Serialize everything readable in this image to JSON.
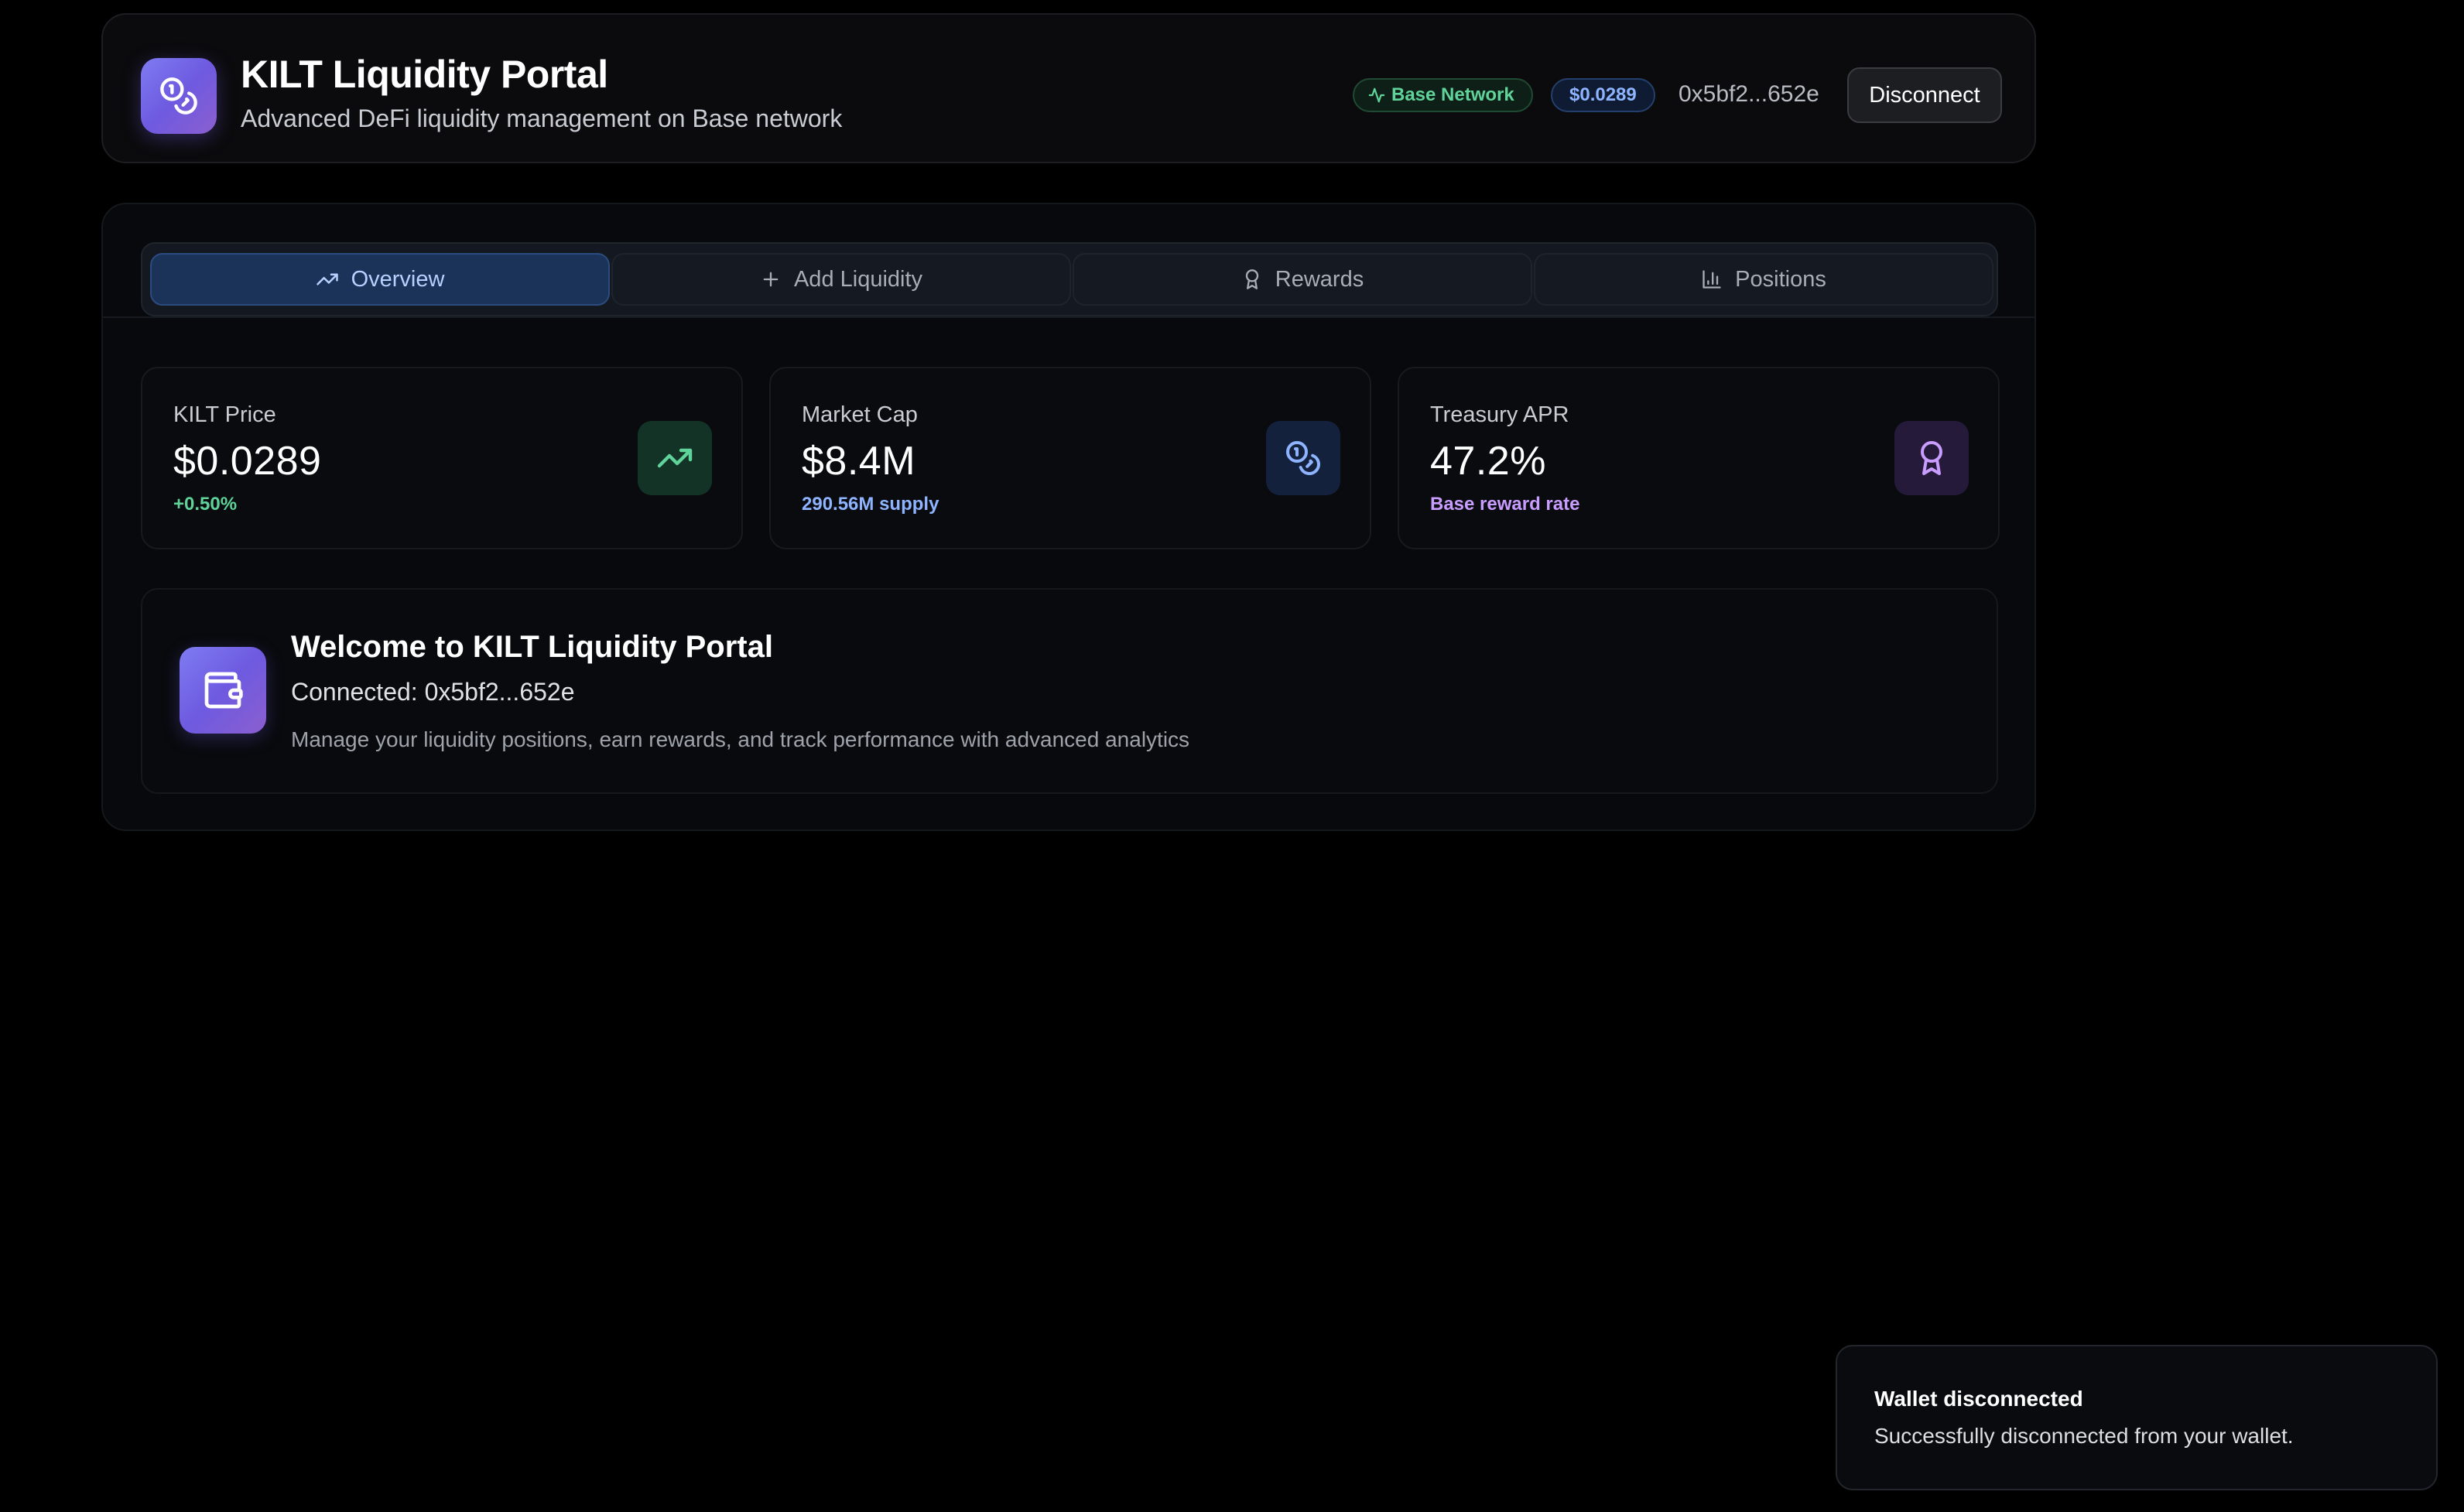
{
  "header": {
    "title": "KILT Liquidity Portal",
    "subtitle": "Advanced DeFi liquidity management on Base network",
    "network_badge": "Base Network",
    "price_badge": "$0.0289",
    "wallet_address": "0x5bf2...652e",
    "disconnect_label": "Disconnect",
    "logo_icon": "coins-icon"
  },
  "tabs": [
    {
      "label": "Overview",
      "icon": "trending-up-icon",
      "active": true
    },
    {
      "label": "Add Liquidity",
      "icon": "plus-icon",
      "active": false
    },
    {
      "label": "Rewards",
      "icon": "award-icon",
      "active": false
    },
    {
      "label": "Positions",
      "icon": "bar-chart-icon",
      "active": false
    }
  ],
  "stats": [
    {
      "label": "KILT Price",
      "value": "$0.0289",
      "note": "+0.50%",
      "note_color": "#5fd39a",
      "icon": "trending-up-icon",
      "icon_bg": "#143327",
      "icon_color": "#5fd39a"
    },
    {
      "label": "Market Cap",
      "value": "$8.4M",
      "note": "290.56M supply",
      "note_color": "#8fb4ff",
      "icon": "coins-icon",
      "icon_bg": "#14213d",
      "icon_color": "#8fb4ff"
    },
    {
      "label": "Treasury APR",
      "value": "47.2%",
      "note": "Base reward rate",
      "note_color": "#c99cff",
      "icon": "award-icon",
      "icon_bg": "#251a3a",
      "icon_color": "#c99cff"
    }
  ],
  "welcome": {
    "title": "Welcome to KILT Liquidity Portal",
    "connected": "Connected: 0x5bf2...652e",
    "description": "Manage your liquidity positions, earn rewards, and track performance with advanced analytics",
    "icon": "wallet-icon"
  },
  "toast": {
    "title": "Wallet disconnected",
    "message": "Successfully disconnected from your wallet."
  },
  "colors": {
    "background": "#000000",
    "accent_purple": "#7a6cf0",
    "accent_green": "#5fd39a",
    "accent_blue": "#8fb4ff",
    "accent_violet": "#c99cff"
  }
}
